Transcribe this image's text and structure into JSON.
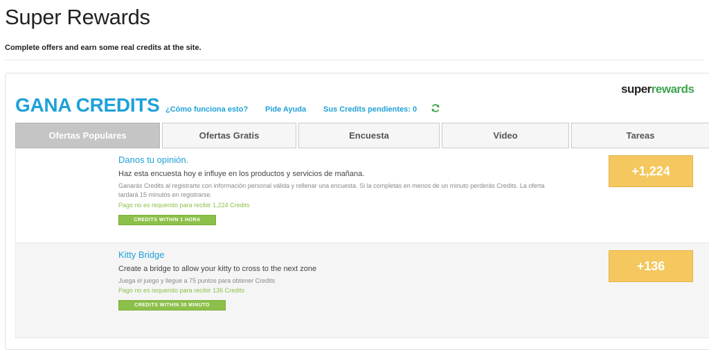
{
  "page": {
    "title": "Super Rewards",
    "subtitle": "Complete offers and earn some real credits at the site."
  },
  "widget": {
    "logo": {
      "part1": "super",
      "part2": "rewards"
    },
    "header_title": "GANA CREDITS",
    "links": {
      "how_it_works": "¿Cómo funciona esto?",
      "help": "Pide Ayuda",
      "pending_credits": "Sus Credits pendientes: 0"
    },
    "refresh_icon": "refresh-icon",
    "tabs": [
      {
        "label": "Ofertas Populares",
        "active": true
      },
      {
        "label": "Ofertas Gratis",
        "active": false
      },
      {
        "label": "Encuesta",
        "active": false
      },
      {
        "label": "Video",
        "active": false
      },
      {
        "label": "Tareas",
        "active": false
      }
    ],
    "offers": [
      {
        "title": "Danos tu opinión.",
        "headline": "Haz esta encuesta hoy e influye en los productos y servicios de mañana.",
        "description": "Ganarás Credits al registrarte con información personal válida y rellenar una encuesta. Si la completas en menos de un minuto perderás Credits. La oferta tardará 15 minutos en registrarse.",
        "note": "Pago no es requerido para recibir 1,224 Credits",
        "badge": "CREDITS WITHIN 1 HORA",
        "amount": "+1,224"
      },
      {
        "title": "Kitty Bridge",
        "headline": "Create a bridge to allow your kitty to cross to the next zone",
        "description": "Juega el juego y llegue a 75 puntos para obtener Credits",
        "note": "Pago no es requerido para recibir 136 Credits",
        "badge": "CREDITS WITHIN 30 MINUTO",
        "amount": "+136"
      }
    ],
    "colors": {
      "accent_blue": "#1ea1d8",
      "green": "#8dc04a",
      "amount_button": "#f4c85e"
    }
  }
}
